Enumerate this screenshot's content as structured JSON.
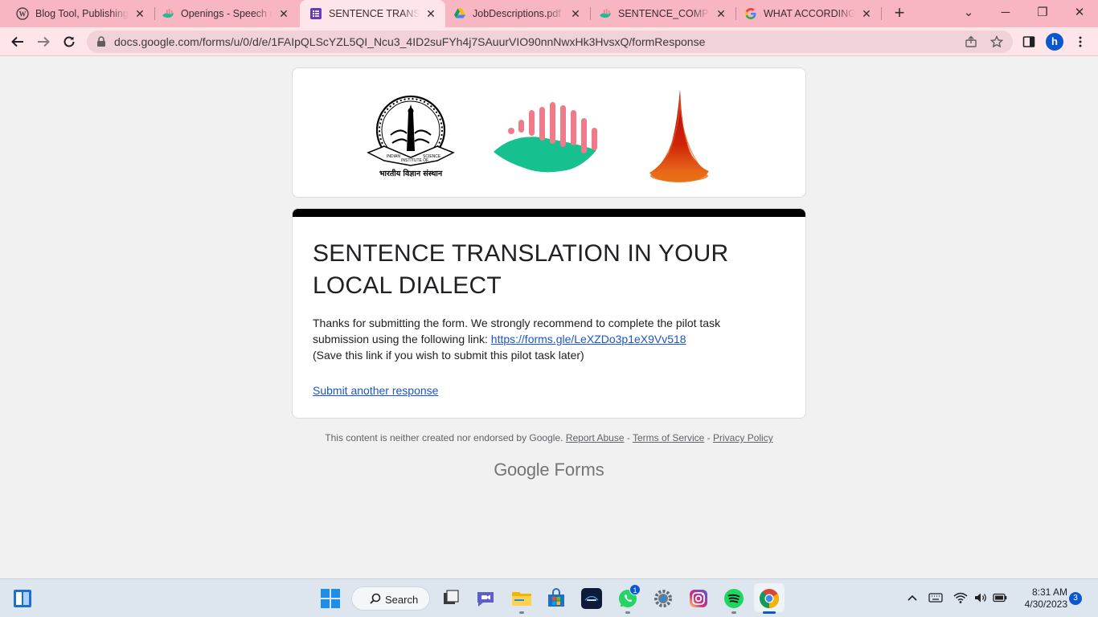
{
  "browser": {
    "tabs": [
      {
        "label": "Blog Tool, Publishing Platform, and CMS",
        "icon": "wordpress-icon"
      },
      {
        "label": "Openings - Speech recognition",
        "icon": "speech-lab-icon"
      },
      {
        "label": "SENTENCE TRANSLATION IN YOUR LOCAL DIALECT",
        "icon": "google-forms-icon"
      },
      {
        "label": "JobDescriptions.pdf - Google Drive",
        "icon": "google-drive-icon"
      },
      {
        "label": "SENTENCE_COMPOSITION",
        "icon": "speech-lab-icon"
      },
      {
        "label": "WHAT ACCORDING TO YOU",
        "icon": "google-icon"
      }
    ],
    "close_glyph": "✕",
    "new_tab_glyph": "+",
    "window_controls": {
      "dropdown": "⌄",
      "minimize": "─",
      "maximize": "❐",
      "close": "✕"
    },
    "url": "docs.google.com/forms/u/0/d/e/1FAIpQLScYZL5QI_Ncu3_4ID2suFYh4j7SAuurVIO90nnNwxHk3HvsxQ/formResponse",
    "profile_initial": "h"
  },
  "form": {
    "title": "SENTENCE TRANSLATION IN YOUR LOCAL DIALECT",
    "message_before_link": "Thanks for submitting the form. We strongly recommend to complete the pilot task submission using the following link: ",
    "link_text": "https://forms.gle/LeXZDo3p1eX9Vv518",
    "message_after_link": "(Save this link if you wish to submit this pilot task later)",
    "submit_another": "Submit another response",
    "logo_text": {
      "iisc_top": "INDIAN",
      "iisc_mid": "INSTITUTE OF",
      "iisc_right": "SCIENCE",
      "iisc_hindi": "भारतीय विज्ञान संस्थान"
    }
  },
  "footer": {
    "disclaimer": "This content is neither created nor endorsed by Google.",
    "report_abuse": "Report Abuse",
    "sep": " - ",
    "terms": "Terms of Service",
    "privacy": "Privacy Policy",
    "brand_google": "Google",
    "brand_forms": "Forms"
  },
  "taskbar": {
    "search_label": "Search",
    "whatsapp_badge": "1",
    "time": "8:31 AM",
    "date": "4/30/2023",
    "notification_count": "3"
  },
  "colors": {
    "tabstrip": "#f7b6c2",
    "toolbar": "#fde5ea",
    "link": "#1a56c6",
    "page_bg": "#f1f1f1"
  }
}
